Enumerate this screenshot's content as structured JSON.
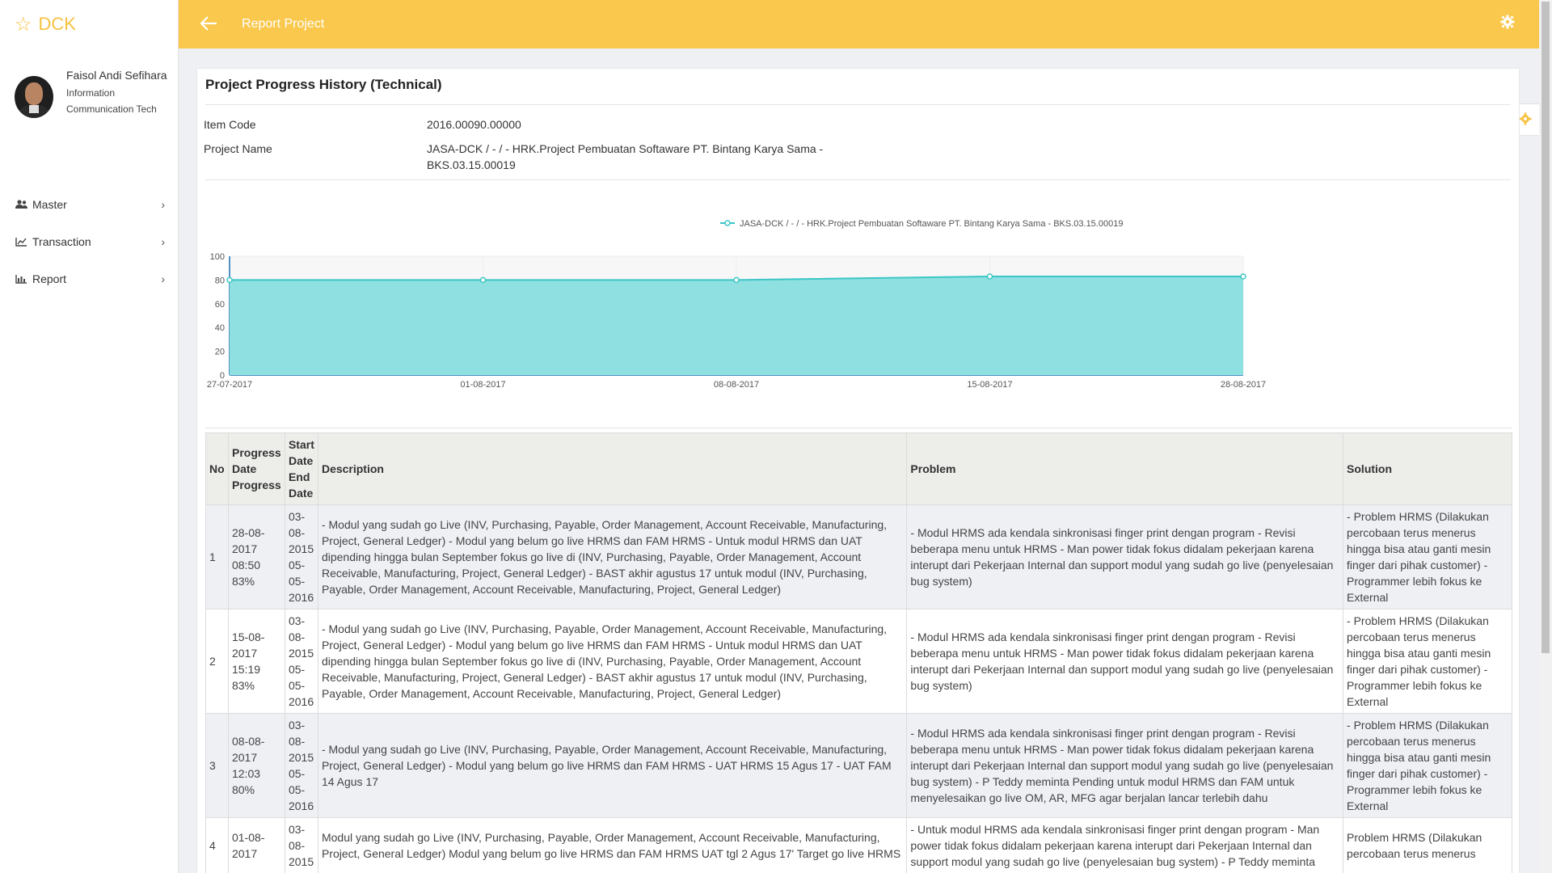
{
  "sidebar": {
    "brand": "DCK",
    "user_name": "Faisol Andi Sefihara",
    "user_dept": "Information Communication Tech",
    "menu": [
      {
        "label": "Master",
        "icon": "users-icon"
      },
      {
        "label": "Transaction",
        "icon": "line-chart-icon"
      },
      {
        "label": "Report",
        "icon": "bar-chart-icon"
      }
    ]
  },
  "header": {
    "title": "Report Project"
  },
  "card": {
    "title": "Project Progress History (Technical)",
    "item_code_label": "Item Code",
    "item_code": "2016.00090.00000",
    "project_name_label": "Project Name",
    "project_name_line1": "JASA-DCK / - / - HRK.Project Pembuatan Softaware PT. Bintang Karya Sama -",
    "project_name_line2": "BKS.03.15.00019"
  },
  "chart_data": {
    "type": "area",
    "title": "",
    "xlabel": "",
    "ylabel": "",
    "legend_position": "top-center",
    "ylim": [
      0,
      100
    ],
    "yticks": [
      0,
      20,
      40,
      60,
      80,
      100
    ],
    "x": [
      "27-07-2017",
      "01-08-2017",
      "08-08-2017",
      "15-08-2017",
      "28-08-2017"
    ],
    "series": [
      {
        "name": "JASA-DCK / - / - HRK.Project Pembuatan Softaware PT. Bintang Karya Sama - BKS.03.15.00019",
        "values": [
          80,
          80,
          80,
          83,
          83
        ],
        "color": "#3cc6c6",
        "fill": "#8fe0e0"
      }
    ]
  },
  "table": {
    "headers": {
      "no": "No",
      "progress": [
        "Progress",
        "Date",
        "Progress"
      ],
      "dates": [
        "Start",
        "Date",
        "End",
        "Date"
      ],
      "description": "Description",
      "problem": "Problem",
      "solution": "Solution"
    },
    "rows": [
      {
        "no": "1",
        "progress_lines": [
          "28-08-",
          "2017",
          "08:50",
          "83%"
        ],
        "date_lines": [
          "03-",
          "08-",
          "2015",
          "05-",
          "05-",
          "2016"
        ],
        "description": "- Modul yang sudah go Live (INV, Purchasing, Payable, Order Management, Account Receivable, Manufacturing, Project, General Ledger) - Modul yang belum go live HRMS dan FAM HRMS - Untuk modul HRMS dan UAT dipending hingga bulan September fokus go live di (INV, Purchasing, Payable, Order Management, Account Receivable, Manufacturing, Project, General Ledger) - BAST akhir agustus 17 untuk modul (INV, Purchasing, Payable, Order Management, Account Receivable, Manufacturing, Project, General Ledger)",
        "problem": "- Modul HRMS ada kendala sinkronisasi finger print dengan program - Revisi beberapa menu untuk HRMS - Man power tidak fokus didalam pekerjaan karena interupt dari Pekerjaan Internal dan support modul yang sudah go live (penyelesaian bug system)",
        "solution": "- Problem HRMS (Dilakukan percobaan terus menerus hingga bisa atau ganti mesin finger dari pihak customer) - Programmer lebih fokus ke External"
      },
      {
        "no": "2",
        "progress_lines": [
          "15-08-",
          "2017",
          "15:19",
          "83%"
        ],
        "date_lines": [
          "03-",
          "08-",
          "2015",
          "05-",
          "05-",
          "2016"
        ],
        "description": "- Modul yang sudah go Live (INV, Purchasing, Payable, Order Management, Account Receivable, Manufacturing, Project, General Ledger) - Modul yang belum go live HRMS dan FAM HRMS - Untuk modul HRMS dan UAT dipending hingga bulan September fokus go live di (INV, Purchasing, Payable, Order Management, Account Receivable, Manufacturing, Project, General Ledger) - BAST akhir agustus 17 untuk modul (INV, Purchasing, Payable, Order Management, Account Receivable, Manufacturing, Project, General Ledger)",
        "problem": "- Modul HRMS ada kendala sinkronisasi finger print dengan program - Revisi beberapa menu untuk HRMS - Man power tidak fokus didalam pekerjaan karena interupt dari Pekerjaan Internal dan support modul yang sudah go live (penyelesaian bug system)",
        "solution": "- Problem HRMS (Dilakukan percobaan terus menerus hingga bisa atau ganti mesin finger dari pihak customer) - Programmer lebih fokus ke External"
      },
      {
        "no": "3",
        "progress_lines": [
          "08-08-",
          "2017",
          "12:03",
          "80%"
        ],
        "date_lines": [
          "03-",
          "08-",
          "2015",
          "05-",
          "05-",
          "2016"
        ],
        "description": "- Modul yang sudah go Live (INV, Purchasing, Payable, Order Management, Account Receivable, Manufacturing, Project, General Ledger) - Modul yang belum go live HRMS dan FAM HRMS - UAT HRMS 15 Agus 17 - UAT FAM 14 Agus 17",
        "problem": "- Modul HRMS ada kendala sinkronisasi finger print dengan program - Revisi beberapa menu untuk HRMS - Man power tidak fokus didalam pekerjaan karena interupt dari Pekerjaan Internal dan support modul yang sudah go live (penyelesaian bug system) - P Teddy meminta Pending untuk modul HRMS dan FAM untuk menyelesaikan go live OM, AR, MFG agar berjalan lancar terlebih dahu",
        "solution": "- Problem HRMS (Dilakukan percobaan terus menerus hingga bisa atau ganti mesin finger dari pihak customer) - Programmer lebih fokus ke External"
      },
      {
        "no": "4",
        "progress_lines": [
          "01-08-",
          "2017",
          "",
          ""
        ],
        "date_lines": [
          "03-",
          "08-",
          "2015",
          "",
          "",
          ""
        ],
        "description": "Modul yang sudah go Live (INV, Purchasing, Payable, Order Management, Account Receivable, Manufacturing, Project, General Ledger) Modul yang belum go live HRMS dan FAM HRMS UAT tgl 2 Agus 17' Target go live HRMS",
        "problem": "- Untuk modul HRMS ada kendala sinkronisasi finger print dengan program - Man power tidak fokus didalam pekerjaan karena interupt dari Pekerjaan Internal dan support modul yang sudah go live (penyelesaian bug system) - P Teddy meminta",
        "solution": "Problem HRMS (Dilakukan percobaan terus menerus"
      }
    ]
  }
}
